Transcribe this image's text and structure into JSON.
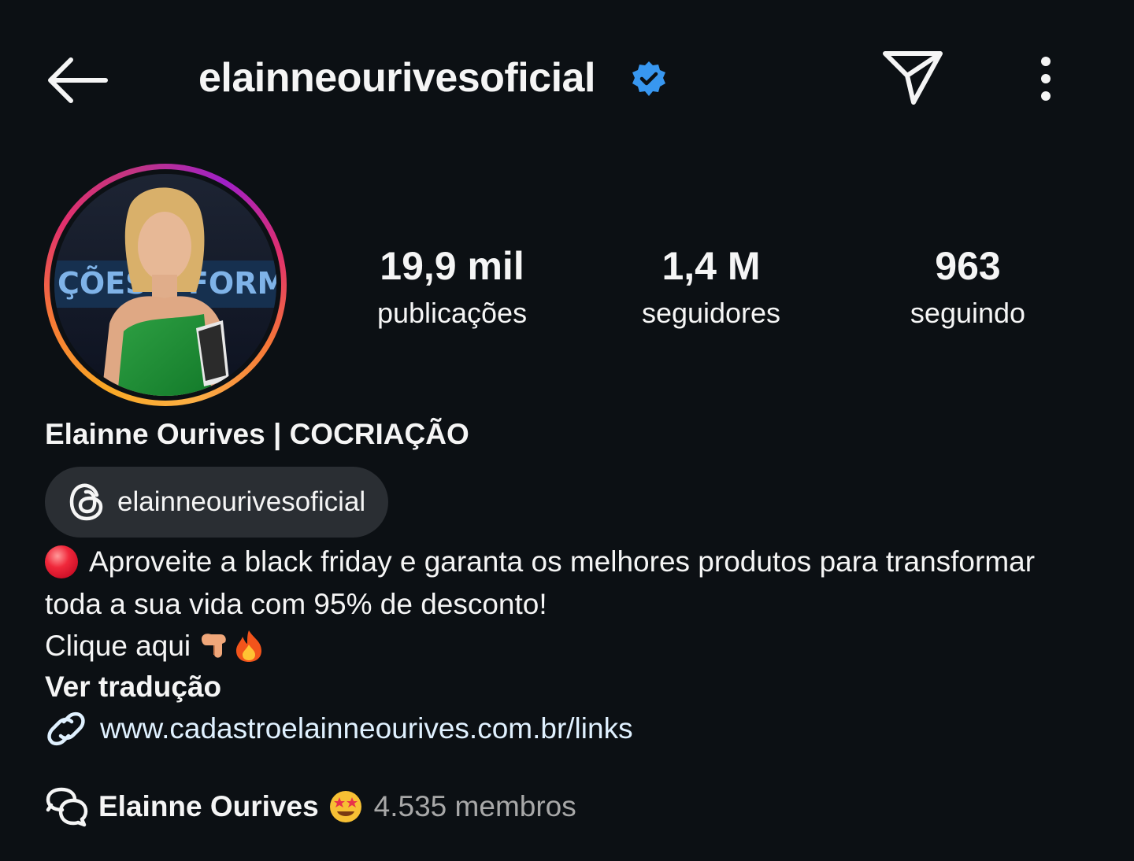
{
  "header": {
    "username": "elainneourivesoficial",
    "verified_color": "#3897f0",
    "icons": [
      "back-arrow-icon",
      "verified-badge-icon",
      "send-icon",
      "more-options-icon"
    ]
  },
  "profile": {
    "avatar_ring_colors": [
      "#f9a825",
      "#e1306c",
      "#a020c8"
    ],
    "avatar_backdrop_text": "ÇÕES E FORMA",
    "stats": {
      "posts": {
        "value": "19,9 mil",
        "label": "publicações"
      },
      "followers": {
        "value": "1,4 M",
        "label": "seguidores"
      },
      "following": {
        "value": "963",
        "label": "seguindo"
      }
    },
    "full_name": "Elainne Ourives | COCRIAÇÃO",
    "threads": {
      "icon": "threads-icon",
      "handle": "elainneourivesoficial"
    }
  },
  "bio": {
    "line1": "Aproveite a black friday e garanta os melhores produtos para transformar",
    "line2": "toda a sua vida com 95% de desconto!",
    "line3": "Clique aqui",
    "see_translation": "Ver tradução"
  },
  "link": {
    "icon": "link-icon",
    "url": "www.cadastroelainneourives.com.br/links",
    "color": "#e0f1ff"
  },
  "channel": {
    "icon": "broadcast-channel-icon",
    "name": "Elainne Ourives",
    "members": "4.535 membros"
  },
  "colors": {
    "background": "#0c1014",
    "chip_background": "#2a2e33",
    "secondary_text": "#a8a8a8"
  }
}
